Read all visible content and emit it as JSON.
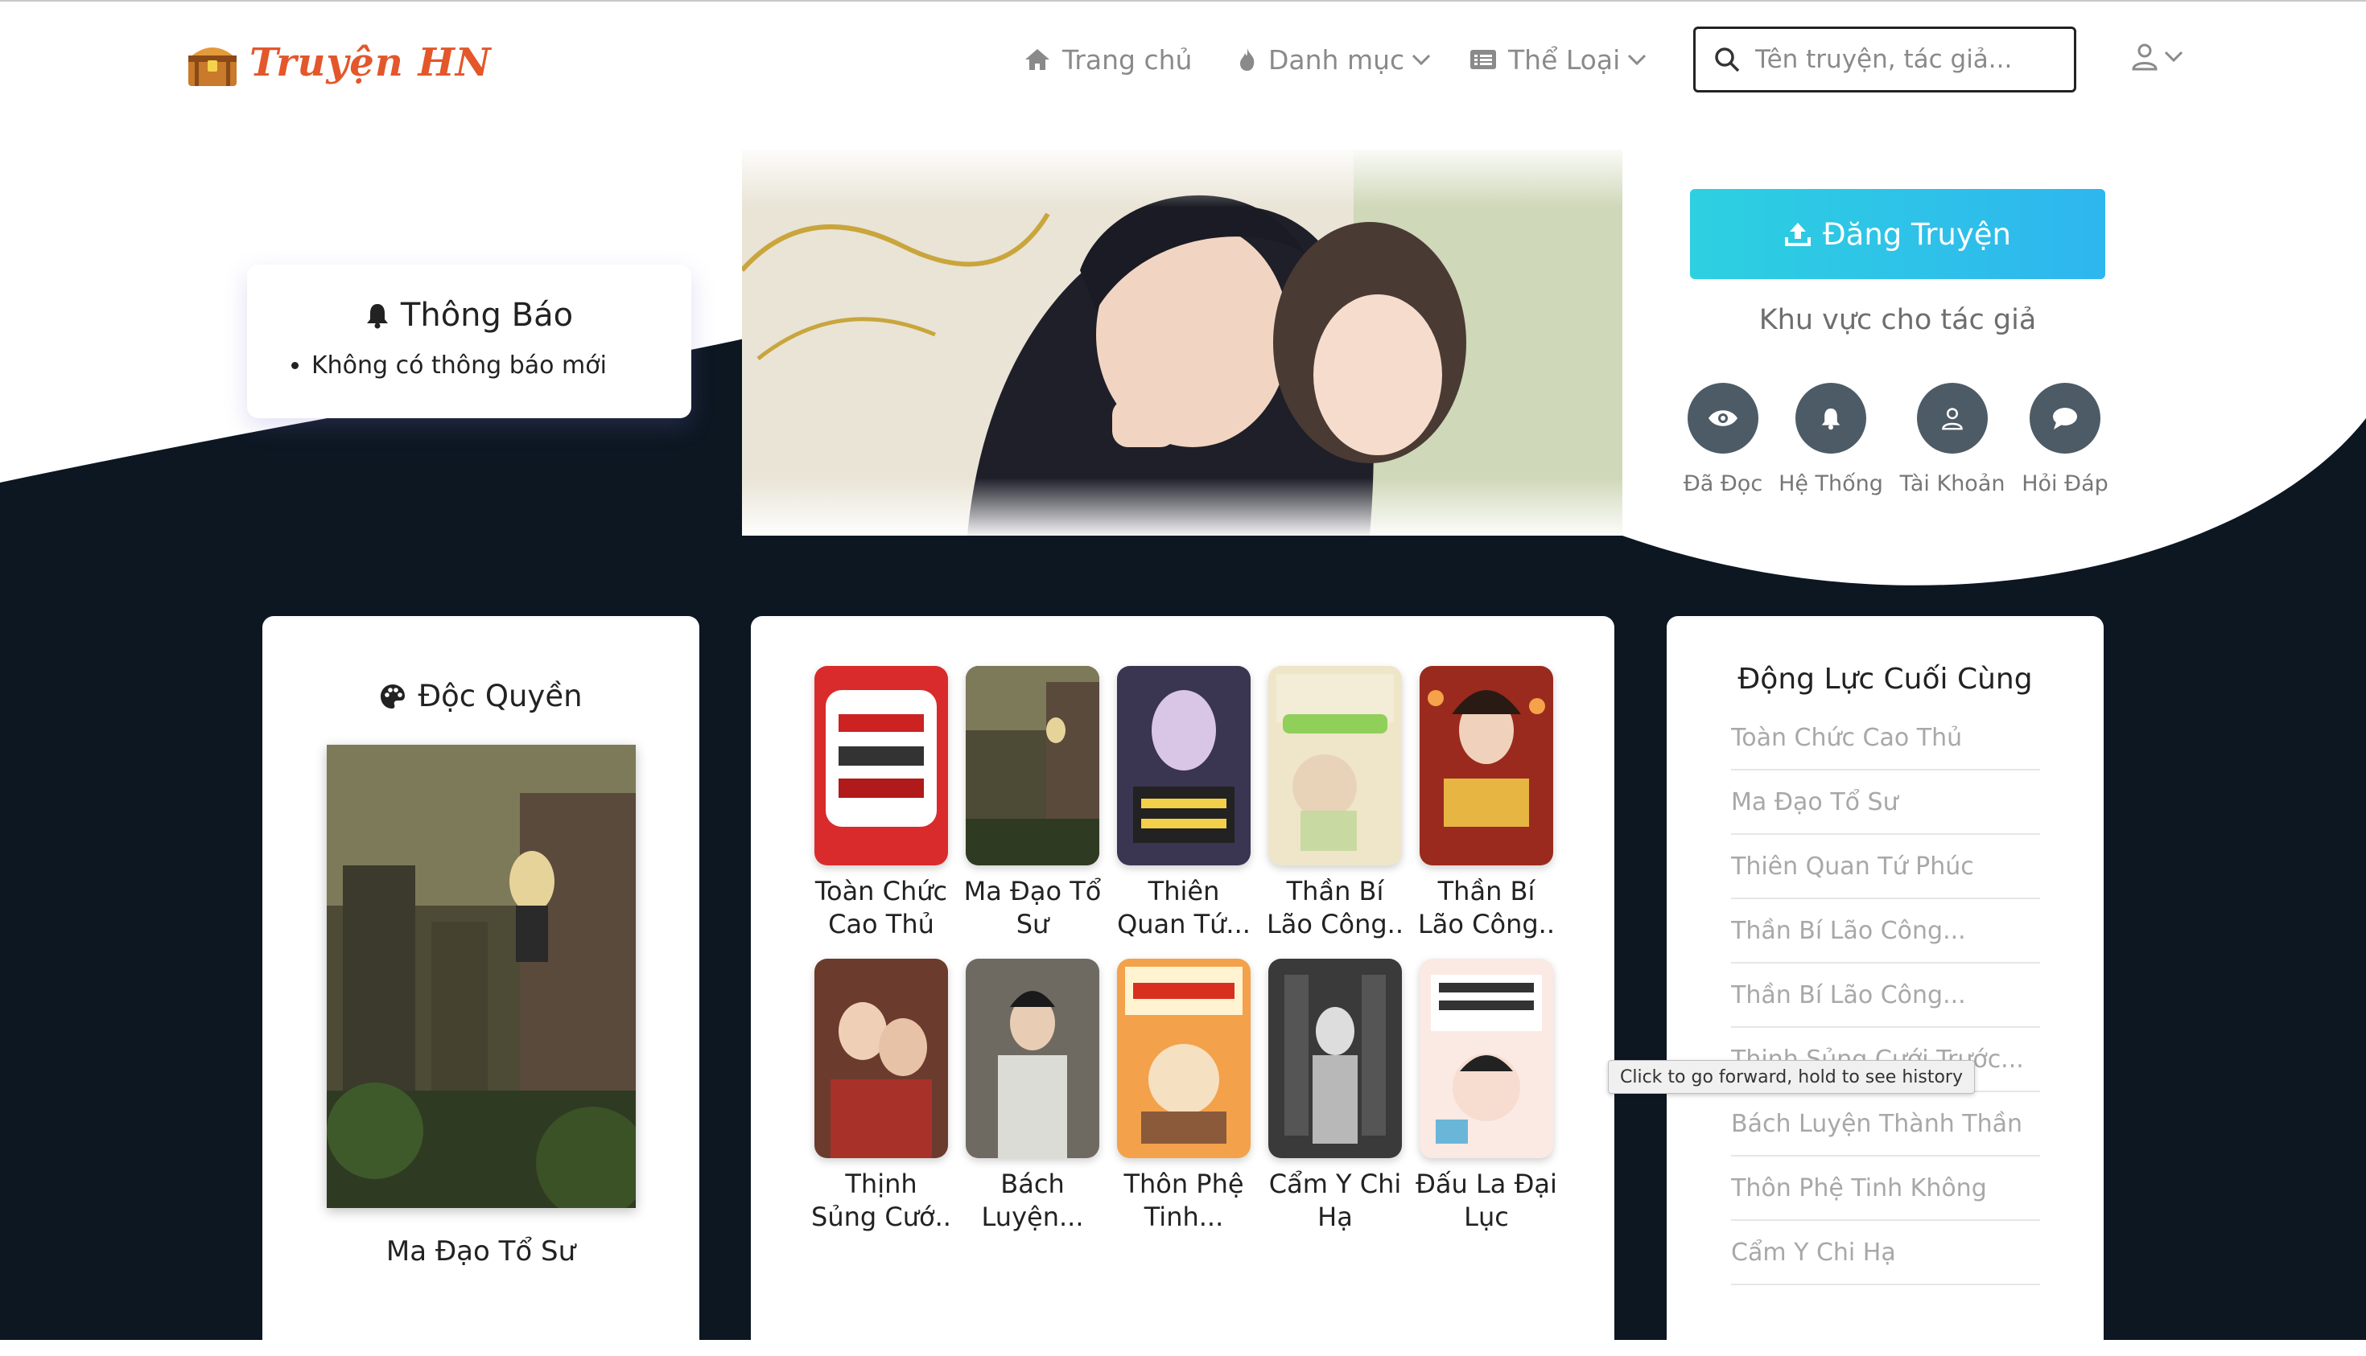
{
  "brand": {
    "name": "Truyện HN"
  },
  "nav": {
    "home": "Trang chủ",
    "categories": "Danh mục",
    "genres": "Thể Loại"
  },
  "search": {
    "placeholder": "Tên truyện, tác giả..."
  },
  "notice": {
    "title": "Thông Báo",
    "items": [
      "Không có thông báo mới"
    ]
  },
  "author": {
    "upload_label": "Đăng Truyện",
    "caption": "Khu vực cho tác giả",
    "quick_links": [
      {
        "label": "Đã Đọc",
        "icon": "eye-icon"
      },
      {
        "label": "Hệ Thống",
        "icon": "bell-icon"
      },
      {
        "label": "Tài Khoản",
        "icon": "user-icon"
      },
      {
        "label": "Hỏi Đáp",
        "icon": "chat-icon"
      }
    ]
  },
  "exclusive": {
    "title": "Độc Quyền",
    "book_title": "Ma Đạo Tổ Sư"
  },
  "featured": {
    "books": [
      {
        "line1": "Toàn Chức",
        "line2": "Cao Thủ"
      },
      {
        "line1": "Ma Đạo Tổ",
        "line2": "Sư"
      },
      {
        "line1": "Thiên",
        "line2": "Quan Tứ..."
      },
      {
        "line1": "Thần Bí",
        "line2": "Lão Công.."
      },
      {
        "line1": "Thần Bí",
        "line2": "Lão Công.."
      },
      {
        "line1": "Thịnh",
        "line2": "Sủng Cướ.."
      },
      {
        "line1": "Bách",
        "line2": "Luyện..."
      },
      {
        "line1": "Thôn Phệ",
        "line2": "Tinh..."
      },
      {
        "line1": "Cẩm Y Chi",
        "line2": "Hạ"
      },
      {
        "line1": "Đấu La Đại",
        "line2": "Lục"
      }
    ]
  },
  "motivation": {
    "title": "Động Lực Cuối Cùng",
    "items": [
      "Toàn Chức Cao Thủ",
      "Ma Đạo Tổ Sư",
      "Thiên Quan Tứ Phúc",
      "Thần Bí Lão Công...",
      "Thần Bí Lão Công...",
      "Thịnh Sủng Cưới Trước...",
      "Bách Luyện Thành Thần",
      "Thôn Phệ Tinh Không",
      "Cẩm Y Chi Hạ"
    ]
  },
  "tooltip": {
    "text": "Click to go forward, hold to see history"
  },
  "colors": {
    "dark_bg": "#0d1722",
    "accent_cyan": "#2ec4ea",
    "logo_orange": "#e3572b",
    "quick_icon_bg": "#4d5b66"
  }
}
